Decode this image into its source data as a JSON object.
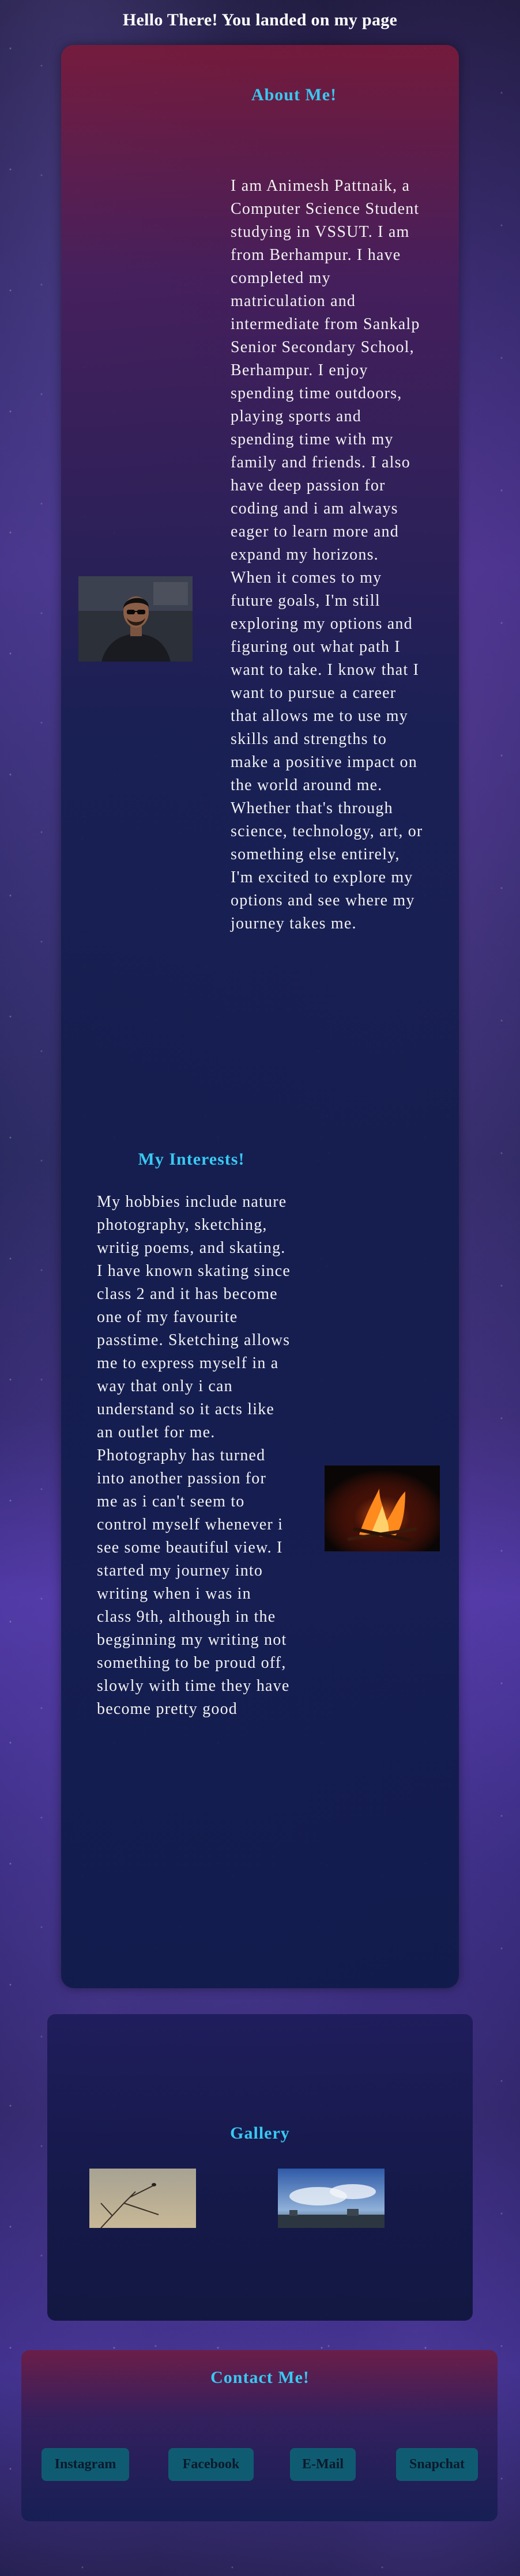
{
  "header": {
    "title": "Hello There! You landed on my page"
  },
  "about": {
    "title": "About Me!",
    "text": "I am Animesh Pattnaik, a Computer Science Student studying in VSSUT. I am from Berhampur. I have completed my matriculation and intermediate from Sankalp Senior Secondary School, Berhampur. I enjoy spending time outdoors, playing sports and spending time with my family and friends. I also have deep passion for coding and i am always eager to learn more and expand my horizons. When it comes to my future goals, I'm still exploring my options and figuring out what path I want to take. I know that I want to pursue a career that allows me to use my skills and strengths to make a positive impact on the world around me. Whether that's through science, technology, art, or something else entirely, I'm excited to explore my options and see where my journey takes me."
  },
  "interests": {
    "title": "My Interests!",
    "text": "My hobbies include nature photography, sketching, writig poems, and skating. I have known skating since class 2 and it has become one of my favourite passtime. Sketching allows me to express myself in a way that only i can understand so it acts like an outlet for me. Photography has turned into another passion for me as i can't seem to control myself whenever i see some beautiful view. I started my journey into writing when i was in class 9th, although in the begginning my writing not something to be proud off, slowly with time they have become pretty good"
  },
  "gallery": {
    "title": "Gallery"
  },
  "contact": {
    "title": "Contact Me!",
    "buttons": {
      "instagram": "Instagram",
      "facebook": "Facebook",
      "email": "E-Mail",
      "snapchat": "Snapchat"
    }
  },
  "colors": {
    "accent": "#38c9f2",
    "button": "#0f5c72",
    "card_top": "#7a1a3a",
    "card_bottom": "#0e1a48"
  }
}
